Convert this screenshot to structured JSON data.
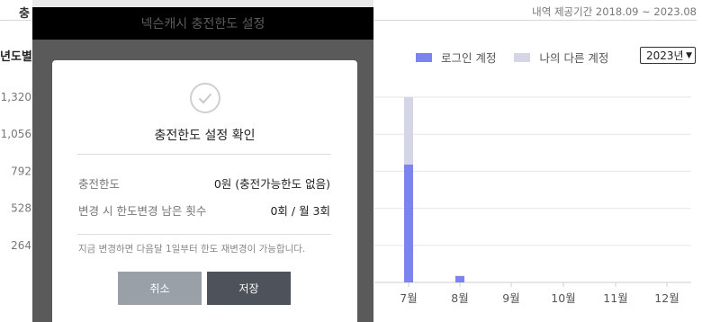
{
  "page": {
    "title_fragment": "충",
    "period": "내역 제공기간 2018.09 ~ 2023.08",
    "yearly_title_fragment": "년도별 ",
    "legend": [
      {
        "label": "로그인 계정",
        "color": "#7b84ec"
      },
      {
        "label": "나의 다른 계정",
        "color": "#d4d5e6"
      }
    ],
    "year_select": "2023년"
  },
  "chart_data": {
    "type": "bar",
    "categories": [
      "7월",
      "8월",
      "9월",
      "10월",
      "11월",
      "12월"
    ],
    "series": [
      {
        "name": "로그인 계정",
        "values": [
          840,
          46,
          0,
          0,
          0,
          0
        ]
      },
      {
        "name": "나의 다른 계정",
        "values": [
          480,
          0,
          0,
          0,
          0,
          0
        ]
      }
    ],
    "y_ticks": [
      "1,320",
      "1,056",
      "792",
      "528",
      "264"
    ],
    "ylim": [
      0,
      1320
    ],
    "stacked": true,
    "grid": true
  },
  "popup": {
    "header_title": "넥슨캐시 충전한도 설정"
  },
  "modal": {
    "icon": "check-circle-icon",
    "title": "충전한도 설정 확인",
    "rows": [
      {
        "label": "충전한도",
        "value": "0원 (충전가능한도 없음)"
      },
      {
        "label": "변경 시 한도변경 남은 횟수",
        "value": "0회 / 월 3회"
      }
    ],
    "notice": "지금 변경하면 다음달 1일부터 한도 재변경이 가능합니다.",
    "cancel_label": "취소",
    "save_label": "저장"
  }
}
